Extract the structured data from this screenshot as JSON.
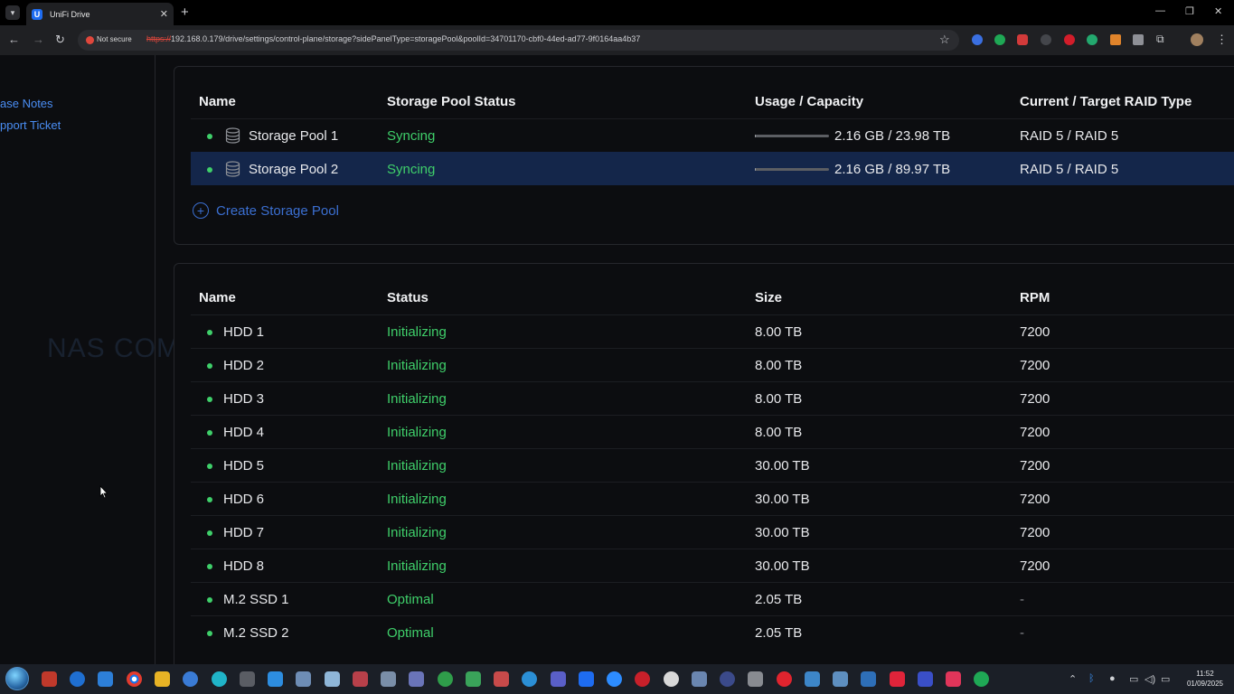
{
  "browser": {
    "tab_title": "UniFi Drive",
    "tab_favicon": "U",
    "not_secure": "Not secure",
    "url_scheme": "https://",
    "url_rest": "192.168.0.179/drive/settings/control-plane/storage?sidePanelType=storagePool&poolId=34701170-cbf0-44ed-ad77-9f0164aa4b37"
  },
  "sidebar": {
    "links": [
      "ase Notes",
      "pport Ticket"
    ]
  },
  "watermark": "NAS COMPARES",
  "pools": {
    "headers": {
      "name": "Name",
      "status": "Storage Pool Status",
      "usage": "Usage / Capacity",
      "raid": "Current / Target RAID Type"
    },
    "rows": [
      {
        "name": "Storage Pool 1",
        "status": "Syncing",
        "usage": "2.16 GB / 23.98 TB",
        "usage_fraction": 0.0001,
        "raid": "RAID 5 / RAID 5",
        "selected": false
      },
      {
        "name": "Storage Pool 2",
        "status": "Syncing",
        "usage": "2.16 GB / 89.97 TB",
        "usage_fraction": 0.0001,
        "raid": "RAID 5 / RAID 5",
        "selected": true
      }
    ],
    "create_label": "Create Storage Pool"
  },
  "drives": {
    "headers": {
      "name": "Name",
      "status": "Status",
      "size": "Size",
      "rpm": "RPM"
    },
    "rows": [
      {
        "name": "HDD 1",
        "status": "Initializing",
        "size": "8.00 TB",
        "rpm": "7200"
      },
      {
        "name": "HDD 2",
        "status": "Initializing",
        "size": "8.00 TB",
        "rpm": "7200"
      },
      {
        "name": "HDD 3",
        "status": "Initializing",
        "size": "8.00 TB",
        "rpm": "7200"
      },
      {
        "name": "HDD 4",
        "status": "Initializing",
        "size": "8.00 TB",
        "rpm": "7200"
      },
      {
        "name": "HDD 5",
        "status": "Initializing",
        "size": "30.00 TB",
        "rpm": "7200"
      },
      {
        "name": "HDD 6",
        "status": "Initializing",
        "size": "30.00 TB",
        "rpm": "7200"
      },
      {
        "name": "HDD 7",
        "status": "Initializing",
        "size": "30.00 TB",
        "rpm": "7200"
      },
      {
        "name": "HDD 8",
        "status": "Initializing",
        "size": "30.00 TB",
        "rpm": "7200"
      },
      {
        "name": "M.2 SSD 1",
        "status": "Optimal",
        "size": "2.05 TB",
        "rpm": "-"
      },
      {
        "name": "M.2 SSD 2",
        "status": "Optimal",
        "size": "2.05 TB",
        "rpm": "-"
      }
    ]
  },
  "taskbar": {
    "time": "11:52",
    "date": "01/09/2025"
  },
  "colors": {
    "accent": "#3b6fd1",
    "status_green": "#3fcf6a",
    "selected_row": "#14264a"
  }
}
